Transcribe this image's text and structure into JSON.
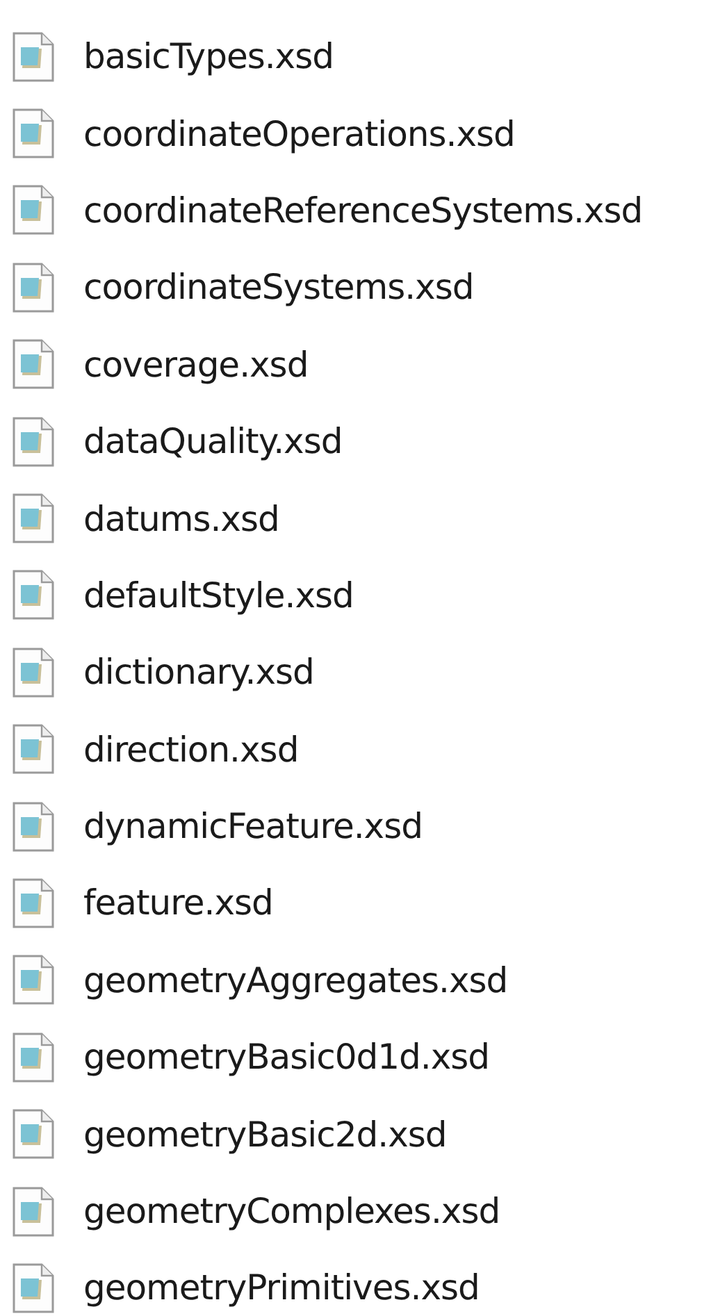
{
  "files": [
    {
      "name": "basicTypes.xsd"
    },
    {
      "name": "coordinateOperations.xsd"
    },
    {
      "name": "coordinateReferenceSystems.xsd"
    },
    {
      "name": "coordinateSystems.xsd"
    },
    {
      "name": "coverage.xsd"
    },
    {
      "name": "dataQuality.xsd"
    },
    {
      "name": "datums.xsd"
    },
    {
      "name": "defaultStyle.xsd"
    },
    {
      "name": "dictionary.xsd"
    },
    {
      "name": "direction.xsd"
    },
    {
      "name": "dynamicFeature.xsd"
    },
    {
      "name": "feature.xsd"
    },
    {
      "name": "geometryAggregates.xsd"
    },
    {
      "name": "geometryBasic0d1d.xsd"
    },
    {
      "name": "geometryBasic2d.xsd"
    },
    {
      "name": "geometryComplexes.xsd"
    },
    {
      "name": "geometryPrimitives.xsd"
    }
  ]
}
